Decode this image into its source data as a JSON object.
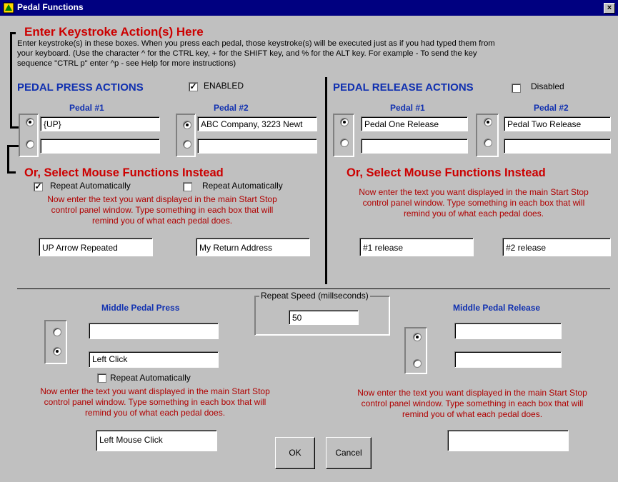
{
  "window": {
    "title": "Pedal Functions",
    "close_glyph": "×"
  },
  "header": {
    "keystroke_title": "Enter Keystroke Action(s) Here",
    "instructions": [
      "Enter keystroke(s) in these boxes. When you press each pedal, those keystroke(s) will be executed just as if you had typed them from",
      "your keyboard.  (Use the character ^ for the CTRL key, + for the SHIFT key, and % for the ALT key. For example - To send the key",
      "sequence \"CTRL p\" enter ^p - see Help for more instructions)"
    ]
  },
  "press": {
    "title": "PEDAL PRESS ACTIONS",
    "enabled_label": "ENABLED",
    "enabled_checked": true,
    "pedal1": {
      "label": "Pedal #1",
      "text": "{UP}",
      "combo": "",
      "selected": "text"
    },
    "pedal2": {
      "label": "Pedal #2",
      "text": "ABC Company, 3223 Newt",
      "combo": "",
      "selected": "text"
    },
    "mouse_title": "Or, Select  Mouse Functions Instead",
    "repeat1_label": "Repeat Automatically",
    "repeat1_checked": true,
    "repeat2_label": "Repeat Automatically",
    "repeat2_checked": false,
    "description": [
      "Now enter the text you want displayed in the main Start Stop",
      "control panel window.  Type something in each box that will",
      "remind you of what each pedal does."
    ],
    "display1": "UP Arrow Repeated",
    "display2": "My Return Address"
  },
  "release": {
    "title": "PEDAL RELEASE ACTIONS",
    "disabled_label": "Disabled",
    "disabled_checked": false,
    "pedal1": {
      "label": "Pedal #1",
      "text": "Pedal One Release",
      "combo": "",
      "selected": "text"
    },
    "pedal2": {
      "label": "Pedal #2",
      "text": "Pedal Two Release",
      "combo": "",
      "selected": "text"
    },
    "mouse_title": "Or, Select  Mouse Functions Instead",
    "description": [
      "Now enter the text you want displayed in the main Start Stop",
      "control panel window.  Type something in each box that will",
      "remind you of what each pedal does."
    ],
    "display1": "#1 release",
    "display2": "#2 release"
  },
  "middle_press": {
    "title": "Middle Pedal Press",
    "text": "",
    "combo": "Left Click",
    "selected": "combo",
    "repeat_label": "Repeat Automatically",
    "repeat_checked": false,
    "description": [
      "Now enter the text you want displayed in the main Start Stop",
      "control panel window.  Type something in each box that will",
      "remind you of what each pedal does."
    ],
    "display": "Left Mouse Click"
  },
  "repeat_speed": {
    "label": "Repeat Speed (millseconds)",
    "value": "50"
  },
  "middle_release": {
    "title": "Middle Pedal Release",
    "text": "",
    "combo": "",
    "selected": "text",
    "description": [
      "Now enter the text you want displayed in the main Start Stop",
      "control panel window.  Type something in each box that will",
      "remind you of what each pedal does."
    ],
    "display": ""
  },
  "buttons": {
    "ok": "OK",
    "cancel": "Cancel"
  },
  "check_glyph": "✓"
}
